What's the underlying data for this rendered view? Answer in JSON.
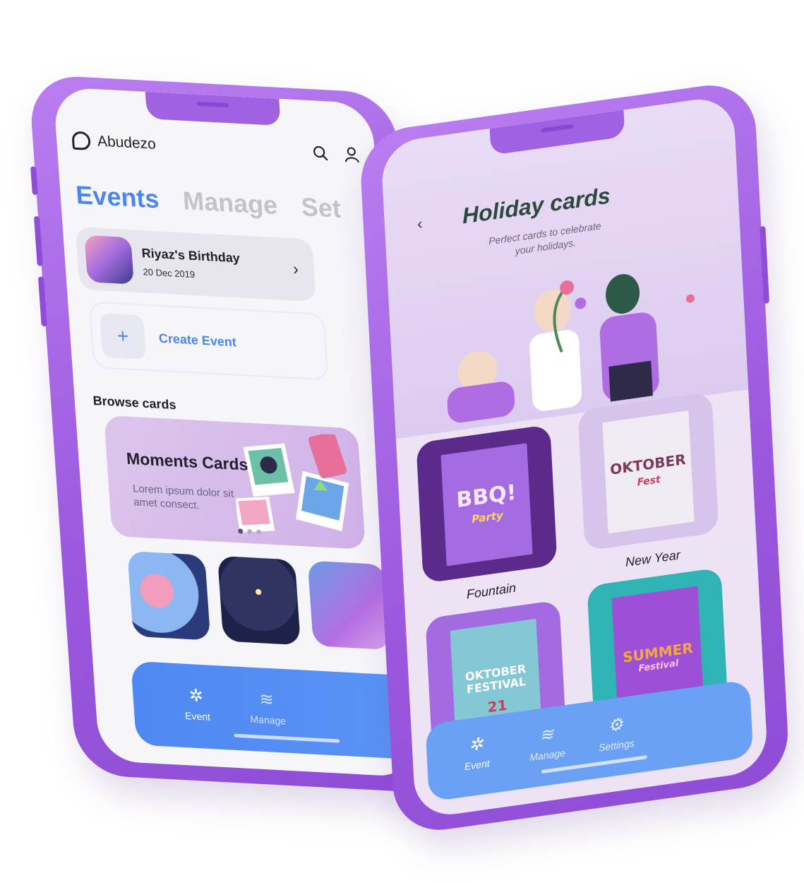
{
  "phone1": {
    "brand": "Abudezo",
    "tabs": [
      "Events",
      "Manage",
      "Set"
    ],
    "event": {
      "title": "Riyaz's Birthday",
      "date": "20 Dec 2019"
    },
    "create_label": "Create Event",
    "browse_label": "Browse cards",
    "moments": {
      "title": "Moments Cards",
      "desc": "Lorem ipsum dolor sit amet consect."
    },
    "nav": {
      "event": "Event",
      "manage": "Manage"
    }
  },
  "phone2": {
    "title": "Holiday cards",
    "subtitle": "Perfect cards to celebrate your holidays.",
    "cards": [
      {
        "name": "Fountain",
        "poster_text": "BBQ!",
        "poster_sub": "Party"
      },
      {
        "name": "New Year",
        "poster_text": "OKTOBER",
        "poster_sub": "Fest"
      },
      {
        "name": "",
        "poster_text": "OKTOBER FESTIVAL",
        "poster_sub": "21"
      },
      {
        "name": "",
        "poster_text": "SUMMER",
        "poster_sub": "Festival"
      }
    ],
    "nav": {
      "event": "Event",
      "manage": "Manage",
      "settings": "Settings"
    }
  },
  "colors": {
    "accent": "#4a86f0",
    "phone_body": "#a062e2"
  },
  "icons": [
    "logo-icon",
    "search-icon",
    "user-icon",
    "chevron-right-icon",
    "plus-icon",
    "spinner-icon",
    "layers-icon",
    "gear-icon",
    "back-icon"
  ]
}
